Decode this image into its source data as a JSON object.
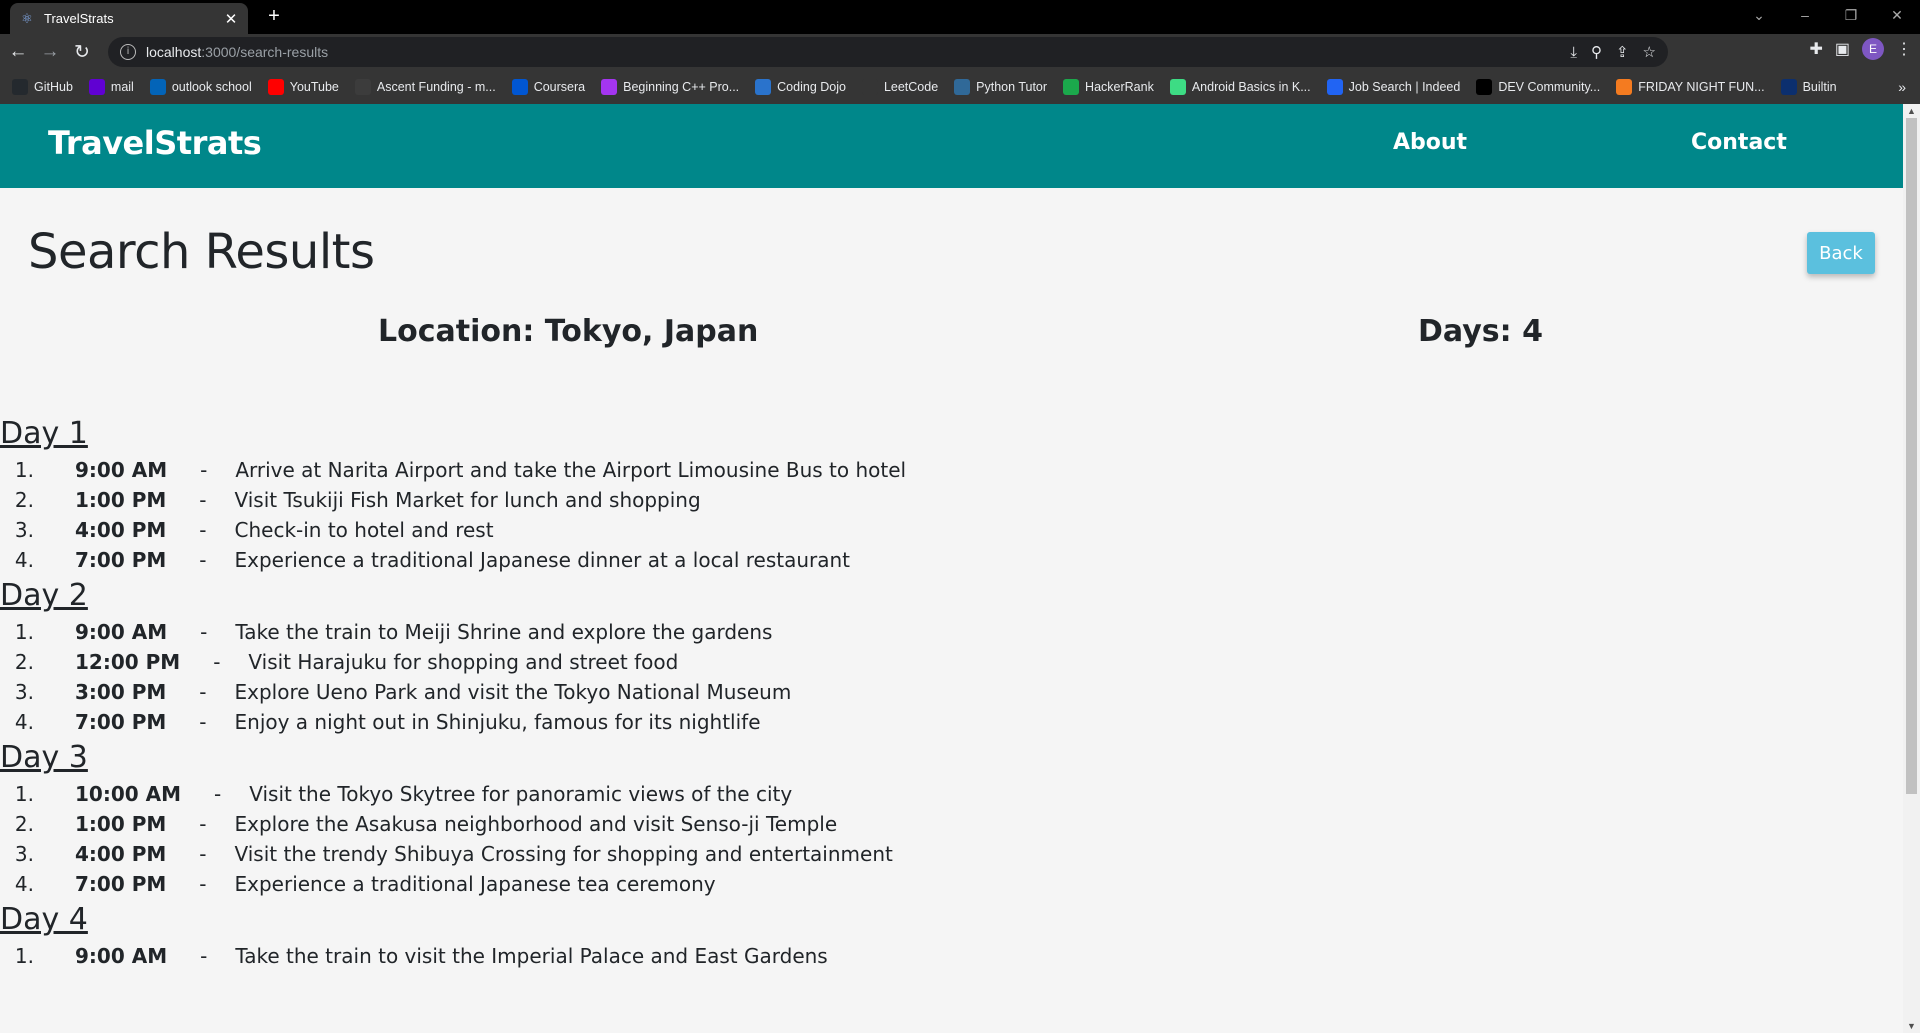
{
  "browser": {
    "tab_title": "TravelStrats",
    "url_host": "localhost",
    "url_path": ":3000/search-results",
    "avatar_letter": "E",
    "bookmarks": [
      {
        "label": "GitHub",
        "color": "#24292e"
      },
      {
        "label": "mail",
        "color": "#6001d2"
      },
      {
        "label": "outlook school",
        "color": "#0364b8"
      },
      {
        "label": "YouTube",
        "color": "#ff0000"
      },
      {
        "label": "Ascent Funding - m...",
        "color": "#3c3c3c"
      },
      {
        "label": "Coursera",
        "color": "#0056d2"
      },
      {
        "label": "Beginning C++ Pro...",
        "color": "#a435f0"
      },
      {
        "label": "Coding Dojo",
        "color": "#2a73cc"
      },
      {
        "label": "LeetCode",
        "color": "#353535"
      },
      {
        "label": "Python Tutor",
        "color": "#306998"
      },
      {
        "label": "HackerRank",
        "color": "#1ba94c"
      },
      {
        "label": "Android Basics in K...",
        "color": "#3ddc84"
      },
      {
        "label": "Job Search | Indeed",
        "color": "#2164f3"
      },
      {
        "label": "DEV Community...",
        "color": "#000000"
      },
      {
        "label": "FRIDAY NIGHT FUN...",
        "color": "#f47b20"
      },
      {
        "label": "Builtin",
        "color": "#0c2f6e"
      }
    ]
  },
  "navbar": {
    "brand": "TravelStrats",
    "about": "About",
    "contact": "Contact",
    "bg_color": "#00878a"
  },
  "page": {
    "heading": "Search Results",
    "back_label": "Back",
    "location": "Location: Tokyo, Japan",
    "days": "Days: 4"
  },
  "itinerary": [
    {
      "title": "Day 1",
      "items": [
        {
          "num": "1.",
          "time": "9:00 AM",
          "sep": "-",
          "desc": "Arrive at Narita Airport and take the Airport Limousine Bus to hotel"
        },
        {
          "num": "2.",
          "time": "1:00 PM",
          "sep": "-",
          "desc": "Visit Tsukiji Fish Market for lunch and shopping"
        },
        {
          "num": "3.",
          "time": "4:00 PM",
          "sep": "-",
          "desc": "Check-in to hotel and rest"
        },
        {
          "num": "4.",
          "time": "7:00 PM",
          "sep": "-",
          "desc": "Experience a traditional Japanese dinner at a local restaurant"
        }
      ]
    },
    {
      "title": "Day 2",
      "items": [
        {
          "num": "1.",
          "time": "9:00 AM",
          "sep": "-",
          "desc": "Take the train to Meiji Shrine and explore the gardens"
        },
        {
          "num": "2.",
          "time": "12:00 PM",
          "sep": "-",
          "desc": "Visit Harajuku for shopping and street food"
        },
        {
          "num": "3.",
          "time": "3:00 PM",
          "sep": "-",
          "desc": "Explore Ueno Park and visit the Tokyo National Museum"
        },
        {
          "num": "4.",
          "time": "7:00 PM",
          "sep": "-",
          "desc": "Enjoy a night out in Shinjuku, famous for its nightlife"
        }
      ]
    },
    {
      "title": "Day 3",
      "items": [
        {
          "num": "1.",
          "time": "10:00 AM",
          "sep": "-",
          "desc": "Visit the Tokyo Skytree for panoramic views of the city"
        },
        {
          "num": "2.",
          "time": "1:00 PM",
          "sep": "-",
          "desc": "Explore the Asakusa neighborhood and visit Senso-ji Temple"
        },
        {
          "num": "3.",
          "time": "4:00 PM",
          "sep": "-",
          "desc": "Visit the trendy Shibuya Crossing for shopping and entertainment"
        },
        {
          "num": "4.",
          "time": "7:00 PM",
          "sep": "-",
          "desc": "Experience a traditional Japanese tea ceremony"
        }
      ]
    },
    {
      "title": "Day 4",
      "items": [
        {
          "num": "1.",
          "time": "9:00 AM",
          "sep": "-",
          "desc": "Take the train to visit the Imperial Palace and East Gardens"
        }
      ]
    }
  ]
}
